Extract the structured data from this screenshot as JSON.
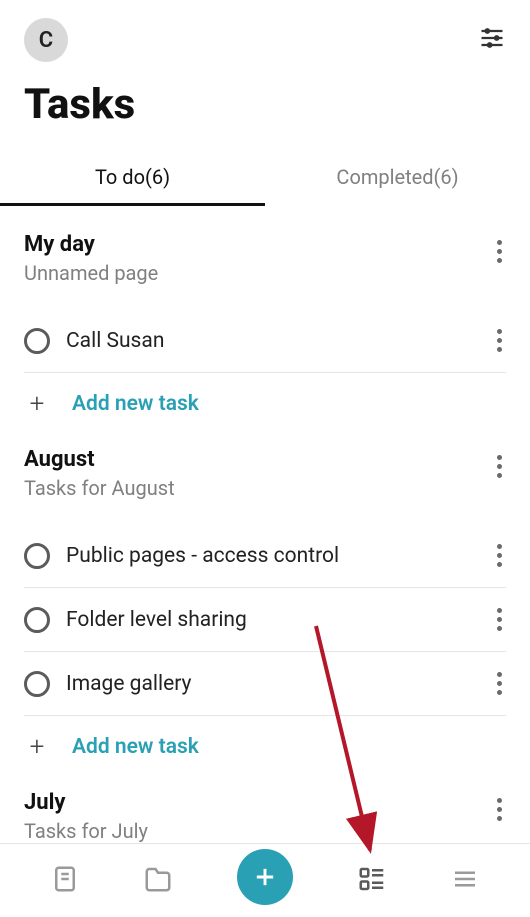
{
  "header": {
    "avatar_initial": "C"
  },
  "page_title": "Tasks",
  "tabs": {
    "todo": {
      "label": "To do",
      "count": "(6)"
    },
    "completed": {
      "label": "Completed",
      "count": "(6)"
    }
  },
  "add_task_label": "Add new task",
  "groups": [
    {
      "title": "My day",
      "subtitle": "Unnamed page",
      "tasks": [
        {
          "label": "Call Susan"
        }
      ]
    },
    {
      "title": "August",
      "subtitle": "Tasks for August",
      "tasks": [
        {
          "label": "Public pages - access control"
        },
        {
          "label": "Folder level sharing"
        },
        {
          "label": "Image gallery"
        }
      ]
    },
    {
      "title": "July",
      "subtitle": "Tasks for July",
      "tasks": []
    }
  ],
  "colors": {
    "accent": "#2aa0b5"
  }
}
